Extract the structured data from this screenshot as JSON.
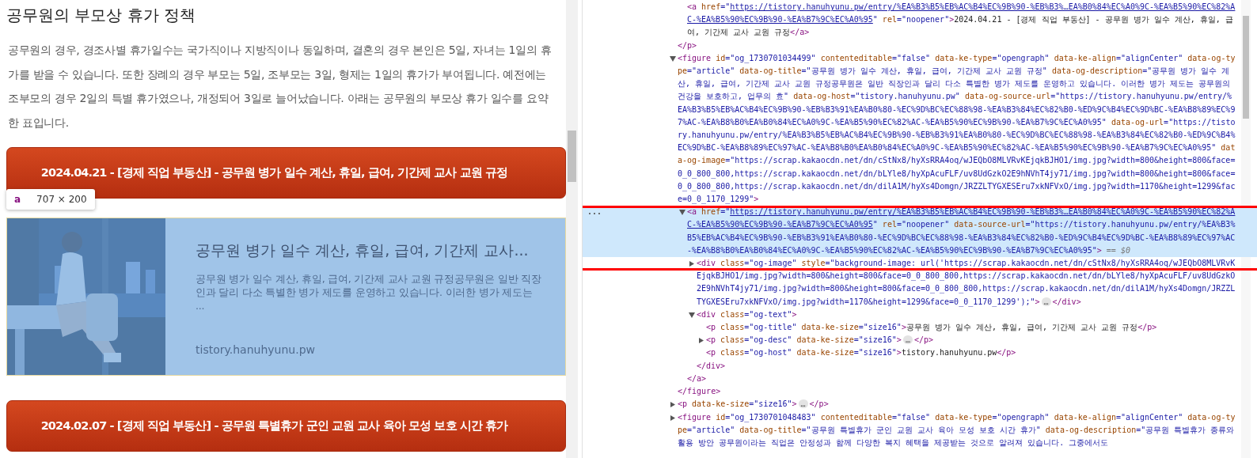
{
  "article": {
    "heading": "공무원의 부모상 휴가 정책",
    "paragraph": "공무원의 경우, 경조사별 휴가일수는 국가직이나 지방직이나 동일하며, 결혼의 경우 본인은 5일, 자녀는 1일의 휴가를 받을 수 있습니다. 또한 장례의 경우 부모는 5일, 조부모는 3일, 형제는 1일의 휴가가 부여됩니다. 예전에는 조부모의 경우 2일의 특별 휴가였으나, 개정되어 3일로 늘어났습니다. 아래는 공무원의 부모상 휴가 일수를 요약한 표입니다.",
    "blocks": [
      {
        "kind": "link_card",
        "label": "2024.04.21 - [경제 직업 부동산] - 공무원 병가 일수 계산, 휴일, 급여, 기간제 교사 교원 규정"
      },
      {
        "kind": "og_card",
        "highlighted": true,
        "tooltip": {
          "tag": "a",
          "size": "707 × 200"
        },
        "title": "공무원 병가 일수 계산, 휴일, 급여, 기간제 교사...",
        "description": "공무원 병가 일수 계산, 휴일, 급여, 기간제 교사 교원 규정공무원은 일반 직장인과 달리 다소 특별한 병가 제도를 운영하고 있습니다. 이러한 병가 제도는 ...",
        "host": "tistory.hanuhyunu.pw"
      },
      {
        "kind": "link_card",
        "label": "2024.02.07 - [경제 직업 부동산] - 공무원 특별휴가 군인 교원 교사 육아 모성 보호 시간 휴가"
      }
    ]
  },
  "elements_tree": [
    {
      "kind": "partial",
      "children": [
        {
          "kind": "element",
          "selected": false,
          "open": [
            {
              "kind": "tag",
              "text": "<a"
            },
            {
              "kind": "attr",
              "text": " href"
            },
            {
              "kind": "val",
              "text": "=\""
            },
            {
              "kind": "link",
              "text": "https://tistory.hanuhyunu.pw/entry/%EA%B3%B5%EB%AC%B4%EC%9B%90-%EB%B3%…EA%B0%84%EC%A0%9C-%EA%B5%90%EC%82%AC-%EA%B5%90%EC%9B%90-%EA%B7%9C%EC%A0%95"
            },
            {
              "kind": "val",
              "text": "\""
            },
            {
              "kind": "attr",
              "text": " rel"
            },
            {
              "kind": "val",
              "text": "=\"noopener\""
            },
            {
              "kind": "tag",
              "text": ">"
            },
            {
              "kind": "text",
              "text": "2024.04.21 - [경제 직업 부동산] - 공무원 병가 일수 계산, 휴일, 급여, 기간제 교사 교원 규정"
            },
            {
              "kind": "tag",
              "text": "</a>"
            }
          ]
        }
      ],
      "close": [
        {
          "kind": "tag",
          "text": "</p>"
        }
      ]
    },
    {
      "kind": "element",
      "expanded": true,
      "selected": false,
      "open": [
        {
          "kind": "tag",
          "text": "<figure"
        },
        {
          "kind": "attr",
          "text": " id"
        },
        {
          "kind": "val",
          "text": "=\"og_1730701034499\""
        },
        {
          "kind": "attr",
          "text": " contenteditable"
        },
        {
          "kind": "val",
          "text": "=\"false\""
        },
        {
          "kind": "attr",
          "text": " data-ke-type"
        },
        {
          "kind": "val",
          "text": "=\"opengraph\""
        },
        {
          "kind": "attr",
          "text": " data-ke-align"
        },
        {
          "kind": "val",
          "text": "=\"alignCenter\""
        },
        {
          "kind": "attr",
          "text": " data-og-type"
        },
        {
          "kind": "val",
          "text": "=\"article\""
        },
        {
          "kind": "attr",
          "text": " data-og-title"
        },
        {
          "kind": "val",
          "text": "=\"공무원 병가 일수 계산, 휴일, 급여, 기간제 교사 교원 규정\""
        },
        {
          "kind": "attr",
          "text": " data-og-description"
        },
        {
          "kind": "val",
          "text": "=\"공무원 병가 일수 계산, 휴일, 급여, 기간제 교사 교원 규정공무원은 일반 직장인과 달리 다소 특별한 병가 제도를 운영하고 있습니다. 이러한 병가 제도는 공무원의 건강을 보호하고, 업무의 효\""
        },
        {
          "kind": "attr",
          "text": " data-og-host"
        },
        {
          "kind": "val",
          "text": "=\"tistory.hanuhyunu.pw\""
        },
        {
          "kind": "attr",
          "text": " data-og-source-url"
        },
        {
          "kind": "val",
          "text": "=\"https://tistory.hanuhyunu.pw/entry/%EA%B3%B5%EB%AC%B4%EC%9B%90-%EB%B3%91%EA%B0%80-%EC%9D%BC%EC%88%98-%EA%B3%84%EC%82%B0-%ED%9C%B4%EC%9D%BC-%EA%B8%89%EC%97%AC-%EA%B8%B0%EA%B0%84%EC%A0%9C-%EA%B5%90%EC%82%AC-%EA%B5%90%EC%9B%90-%EA%B7%9C%EC%A0%95\""
        },
        {
          "kind": "attr",
          "text": " data-og-url"
        },
        {
          "kind": "val",
          "text": "=\"https://tistory.hanuhyunu.pw/entry/%EA%B3%B5%EB%AC%B4%EC%9B%90-%EB%B3%91%EA%B0%80-%EC%9D%BC%EC%88%98-%EA%B3%84%EC%82%B0-%ED%9C%B4%EC%9D%BC-%EA%B8%89%EC%97%AC-%EA%B8%B0%EA%B0%84%EC%A0%9C-%EA%B5%90%EC%82%AC-%EA%B5%90%EC%9B%90-%EA%B7%9C%EC%A0%95\""
        },
        {
          "kind": "attr",
          "text": " data-og-image"
        },
        {
          "kind": "val",
          "text": "=\"https://scrap.kakaocdn.net/dn/cStNx8/hyXsRRA4oq/wJEQbO8MLVRvKEjqkBJHO1/img.jpg?width=800&height=800&face=0_0_800_800,https://scrap.kakaocdn.net/dn/bLYle8/hyXpAcuFLF/uv8UdGzkO2E9hNVhT4jy71/img.jpg?width=800&height=800&face=0_0_800_800,https://scrap.kakaocdn.net/dn/dilA1M/hyXs4Domgn/JRZZLTYGXESEru7xkNFVxO/img.jpg?width=1170&height=1299&face=0_0_1170_1299\""
        },
        {
          "kind": "tag",
          "text": ">"
        }
      ],
      "children": [
        {
          "kind": "element",
          "expanded": true,
          "selected": true,
          "framed": true,
          "gutter_marker": "...",
          "open": [
            {
              "kind": "tag",
              "text": "<a"
            },
            {
              "kind": "attr",
              "text": " href"
            },
            {
              "kind": "val",
              "text": "=\""
            },
            {
              "kind": "link",
              "text": "https://tistory.hanuhyunu.pw/entry/%EA%B3%B5%EB%AC%B4%EC%9B%90-%EB%B3%…EA%B0%84%EC%A0%9C-%EA%B5%90%EC%82%AC-%EA%B5%90%EC%9B%90-%EA%B7%9C%EC%A0%95"
            },
            {
              "kind": "val",
              "text": "\""
            },
            {
              "kind": "attr",
              "text": " rel"
            },
            {
              "kind": "val",
              "text": "=\"noopener\""
            },
            {
              "kind": "attr",
              "text": " data-source-url"
            },
            {
              "kind": "val",
              "text": "=\"https://tistory.hanuhyunu.pw/entry/%EA%B3%B5%EB%AC%B4%EC%9B%90-%EB%B3%91%EA%B0%80-%EC%9D%BC%EC%88%98-%EA%B3%84%EC%82%B0-%ED%9C%B4%EC%9D%BC-%EA%B8%89%EC%97%AC-%EA%B8%B0%EA%B0%84%EC%A0%9C-%EA%B5%90%EC%82%AC-%EA%B5%90%EC%9B%90-%EA%B7%9C%EC%A0%95\""
            },
            {
              "kind": "tag",
              "text": ">"
            },
            {
              "kind": "ref",
              "text": " == $0"
            }
          ],
          "children": [
            {
              "kind": "element",
              "expanded": false,
              "selected": false,
              "open": [
                {
                  "kind": "tag",
                  "text": "<div"
                },
                {
                  "kind": "attr",
                  "text": " class"
                },
                {
                  "kind": "val",
                  "text": "=\"og-image\""
                },
                {
                  "kind": "attr",
                  "text": " style"
                },
                {
                  "kind": "val",
                  "text": "=\"background-image: url('https://scrap.kakaocdn.net/dn/cStNx8/hyXsRRA4oq/wJEQbO8MLVRvKEjqkBJHO1/img.jpg?width=800&height=800&face=0_0_800_800,https://scrap.kakaocdn.net/dn/bLYle8/hyXpAcuFLF/uv8UdGzkO2E9hNVhT4jy71/img.jpg?width=800&height=800&face=0_0_800_800,https://scrap.kakaocdn.net/dn/dilA1M/hyXs4Domgn/JRZZLTYGXESEru7xkNFVxO/img.jpg?width=1170&height=1299&face=0_0_1170_1299');\""
                },
                {
                  "kind": "tag",
                  "text": ">"
                },
                {
                  "kind": "more",
                  "text": "…"
                },
                {
                  "kind": "tag",
                  "text": "</div>"
                }
              ]
            },
            {
              "kind": "element",
              "expanded": true,
              "selected": false,
              "open": [
                {
                  "kind": "tag",
                  "text": "<div"
                },
                {
                  "kind": "attr",
                  "text": " class"
                },
                {
                  "kind": "val",
                  "text": "=\"og-text\""
                },
                {
                  "kind": "tag",
                  "text": ">"
                }
              ],
              "children": [
                {
                  "kind": "element",
                  "selected": false,
                  "open": [
                    {
                      "kind": "tag",
                      "text": "<p"
                    },
                    {
                      "kind": "attr",
                      "text": " class"
                    },
                    {
                      "kind": "val",
                      "text": "=\"og-title\""
                    },
                    {
                      "kind": "attr",
                      "text": " data-ke-size"
                    },
                    {
                      "kind": "val",
                      "text": "=\"size16\""
                    },
                    {
                      "kind": "tag",
                      "text": ">"
                    },
                    {
                      "kind": "text",
                      "text": "공무원 병가 일수 계산, 휴일, 급여, 기간제 교사 교원 규정"
                    },
                    {
                      "kind": "tag",
                      "text": "</p>"
                    }
                  ]
                },
                {
                  "kind": "element",
                  "expanded": false,
                  "selected": false,
                  "open": [
                    {
                      "kind": "tag",
                      "text": "<p"
                    },
                    {
                      "kind": "attr",
                      "text": " class"
                    },
                    {
                      "kind": "val",
                      "text": "=\"og-desc\""
                    },
                    {
                      "kind": "attr",
                      "text": " data-ke-size"
                    },
                    {
                      "kind": "val",
                      "text": "=\"size16\""
                    },
                    {
                      "kind": "tag",
                      "text": ">"
                    },
                    {
                      "kind": "more",
                      "text": "…"
                    },
                    {
                      "kind": "tag",
                      "text": "</p>"
                    }
                  ]
                },
                {
                  "kind": "element",
                  "selected": false,
                  "open": [
                    {
                      "kind": "tag",
                      "text": "<p"
                    },
                    {
                      "kind": "attr",
                      "text": " class"
                    },
                    {
                      "kind": "val",
                      "text": "=\"og-host\""
                    },
                    {
                      "kind": "attr",
                      "text": " data-ke-size"
                    },
                    {
                      "kind": "val",
                      "text": "=\"size16\""
                    },
                    {
                      "kind": "tag",
                      "text": ">"
                    },
                    {
                      "kind": "text",
                      "text": "tistory.hanuhyunu.pw"
                    },
                    {
                      "kind": "tag",
                      "text": "</p>"
                    }
                  ]
                }
              ],
              "close": [
                {
                  "kind": "tag",
                  "text": "</div>"
                }
              ]
            }
          ],
          "close": [
            {
              "kind": "tag",
              "text": "</a>"
            }
          ]
        }
      ],
      "close": [
        {
          "kind": "tag",
          "text": "</figure>"
        }
      ]
    },
    {
      "kind": "element",
      "expanded": false,
      "selected": false,
      "open": [
        {
          "kind": "tag",
          "text": "<p"
        },
        {
          "kind": "attr",
          "text": " data-ke-size"
        },
        {
          "kind": "val",
          "text": "=\"size16\""
        },
        {
          "kind": "tag",
          "text": ">"
        },
        {
          "kind": "more",
          "text": "…"
        },
        {
          "kind": "tag",
          "text": "</p>"
        }
      ]
    },
    {
      "kind": "element",
      "expanded": false,
      "selected": false,
      "open": [
        {
          "kind": "tag",
          "text": "<figure"
        },
        {
          "kind": "attr",
          "text": " id"
        },
        {
          "kind": "val",
          "text": "=\"og_1730701048483\""
        },
        {
          "kind": "attr",
          "text": " contenteditable"
        },
        {
          "kind": "val",
          "text": "=\"false\""
        },
        {
          "kind": "attr",
          "text": " data-ke-type"
        },
        {
          "kind": "val",
          "text": "=\"opengraph\""
        },
        {
          "kind": "attr",
          "text": " data-ke-align"
        },
        {
          "kind": "val",
          "text": "=\"alignCenter\""
        },
        {
          "kind": "attr",
          "text": " data-og-type"
        },
        {
          "kind": "val",
          "text": "=\"article\""
        },
        {
          "kind": "attr",
          "text": " data-og-title"
        },
        {
          "kind": "val",
          "text": "=\"공무원 특별휴가 군인 교원 교사 육아 모성 보호 시간 휴가\""
        },
        {
          "kind": "attr",
          "text": " data-og-description"
        },
        {
          "kind": "val",
          "text": "=\"공무원 특별휴가 종류와 활용 방안 공무원이라는 직업은 안정성과 함께 다양한 복지 혜택을 제공받는 것으로 알려져 있습니다. 그중에서도"
        }
      ]
    }
  ]
}
